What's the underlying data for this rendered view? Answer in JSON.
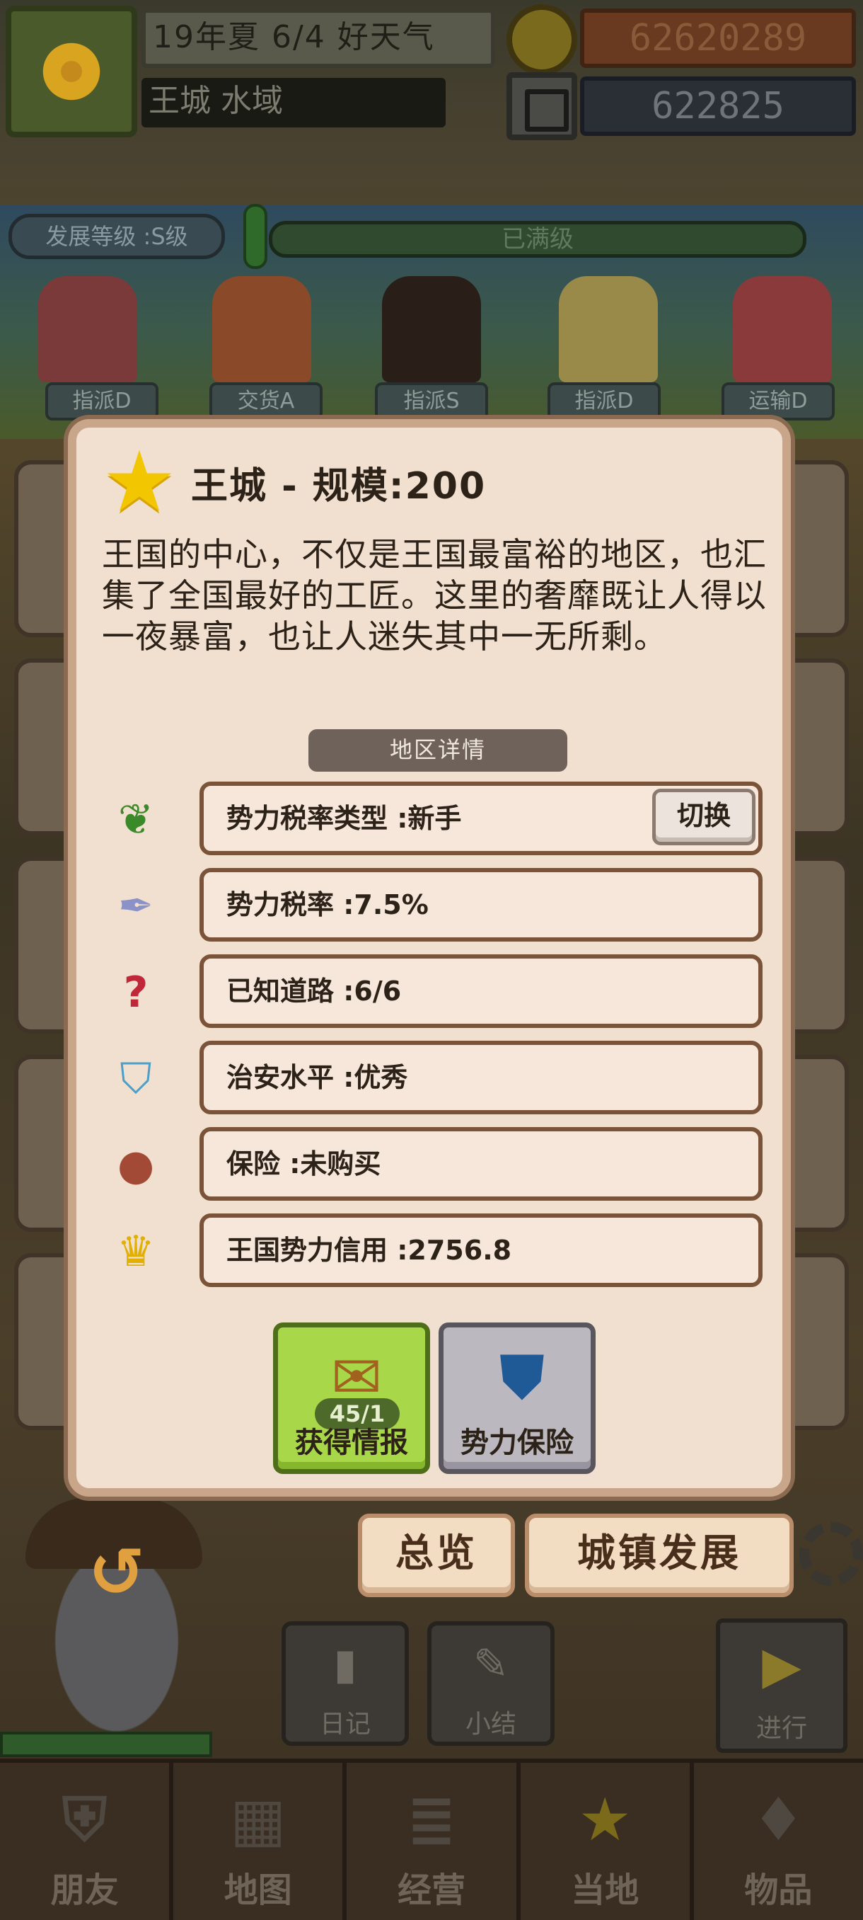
{
  "hud": {
    "date": "19年夏 6/4 好天气",
    "location": "王城 水域",
    "gold": "62620289",
    "gems": "622825",
    "level_label": "发展等级 :S级",
    "level_bar": "已满级"
  },
  "assignments": [
    "指派D",
    "交货A",
    "指派S",
    "指派D",
    "运输D"
  ],
  "modal": {
    "title": "王城 - 规模:200",
    "description": "王国的中心，不仅是王国最富裕的地区，也汇集了全国最好的工匠。这里的奢靡既让人得以一夜暴富，也让人迷失其中一无所剩。",
    "section_header": "地区详情",
    "details": [
      {
        "icon": "sprout-icon",
        "text": "势力税率类型 :新手"
      },
      {
        "icon": "feather-icon",
        "text": "势力税率 :7.5%"
      },
      {
        "icon": "question-icon",
        "text": "已知道路 :6/6"
      },
      {
        "icon": "shield-icon",
        "text": "治安水平 :优秀"
      },
      {
        "icon": "pot-icon",
        "text": "保险 :未购买"
      },
      {
        "icon": "crown-icon",
        "text": "王国势力信用 :2756.8"
      }
    ],
    "switch_label": "切换",
    "intel_count": "45/1",
    "intel_label": "获得情报",
    "insure_label": "势力保险"
  },
  "actions": {
    "overview": "总览",
    "develop": "城镇发展"
  },
  "side_buttons": {
    "diary": "日记",
    "summary": "小结",
    "proceed": "进行"
  },
  "nav": [
    "朋友",
    "地图",
    "经营",
    "当地",
    "物品"
  ]
}
